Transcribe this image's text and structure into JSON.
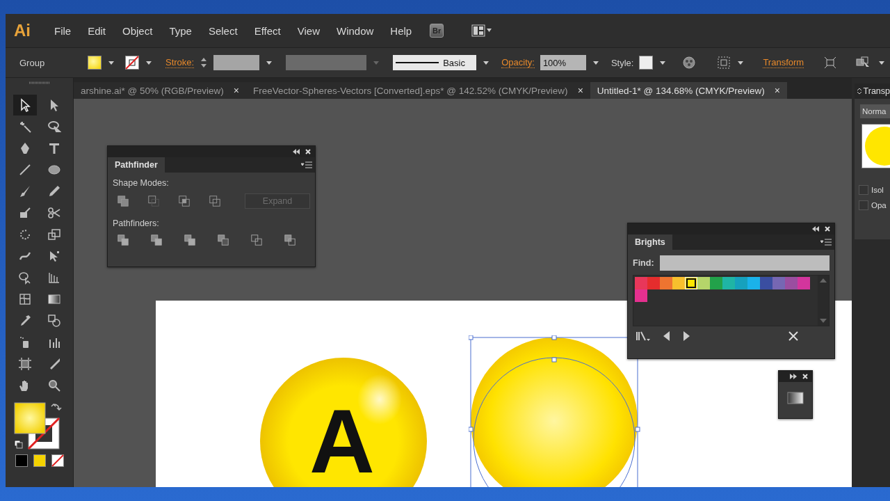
{
  "app": {
    "logo": "Ai",
    "menus": [
      "File",
      "Edit",
      "Object",
      "Type",
      "Select",
      "Effect",
      "View",
      "Window",
      "Help"
    ],
    "bridge_button": "Br"
  },
  "control_bar": {
    "selection_label": "Group",
    "stroke_label": "Stroke:",
    "brush_label": "Basic",
    "opacity_label": "Opacity:",
    "opacity_value": "100%",
    "style_label": "Style:",
    "transform_link": "Transform"
  },
  "document_tabs": [
    {
      "title": "arshine.ai* @ 50% (RGB/Preview)",
      "close": "×",
      "selected": false
    },
    {
      "title": "FreeVector-Spheres-Vectors [Converted].eps* @ 142.52% (CMYK/Preview)",
      "close": "×",
      "selected": false
    },
    {
      "title": "Untitled-1* @ 134.68% (CMYK/Preview)",
      "close": "×",
      "selected": true
    }
  ],
  "tools": [
    {
      "selected": true
    },
    {
      "selected": false
    },
    {
      "selected": false
    },
    {
      "selected": false
    },
    {
      "selected": false
    },
    {
      "selected": false
    },
    {
      "selected": false
    },
    {
      "selected": false
    },
    {
      "selected": false
    },
    {
      "selected": false
    },
    {
      "selected": false
    },
    {
      "selected": false
    },
    {
      "selected": false
    },
    {
      "selected": false
    },
    {
      "selected": false
    },
    {
      "selected": false
    },
    {
      "selected": false
    },
    {
      "selected": false
    },
    {
      "selected": false
    },
    {
      "selected": false
    },
    {
      "selected": false
    },
    {
      "selected": false
    },
    {
      "selected": false
    },
    {
      "selected": false
    },
    {
      "selected": false
    },
    {
      "selected": false
    },
    {
      "selected": false
    },
    {
      "selected": false
    }
  ],
  "pathfinder_panel": {
    "title": "Pathfinder",
    "shape_modes_label": "Shape Modes:",
    "expand_button": {
      "label": "Expand",
      "disabled": true
    },
    "pathfinders_label": "Pathfinders:"
  },
  "swatches_panel": {
    "title": "Brights",
    "find_label": "Find:",
    "swatches": [
      {
        "color": "#e8375a",
        "selected": false
      },
      {
        "color": "#e52d2d",
        "selected": false
      },
      {
        "color": "#ee7430",
        "selected": false
      },
      {
        "color": "#f7c02d",
        "selected": false
      },
      {
        "color": "#ffe600",
        "selected": true
      },
      {
        "color": "#b5d56a",
        "selected": false
      },
      {
        "color": "#22a24a",
        "selected": false
      },
      {
        "color": "#1fb5a5",
        "selected": false
      },
      {
        "color": "#16a1bd",
        "selected": false
      },
      {
        "color": "#1ab2ea",
        "selected": false
      },
      {
        "color": "#3a4ea1",
        "selected": false
      },
      {
        "color": "#7667b3",
        "selected": false
      },
      {
        "color": "#9a4ea0",
        "selected": false
      },
      {
        "color": "#d3359d",
        "selected": false
      },
      {
        "color": "#e5308f",
        "selected": false
      }
    ]
  },
  "right_dock": {
    "panel_tab": "Transp",
    "blend_mode": "Norma",
    "options": [
      {
        "label": "Isol",
        "checked": false
      },
      {
        "label": "Opa",
        "checked": false
      }
    ]
  },
  "artwork": {
    "letter": "A"
  }
}
